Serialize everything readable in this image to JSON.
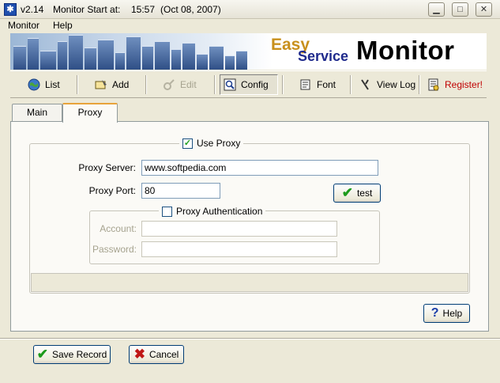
{
  "window": {
    "version": "v2.14",
    "start_label": "Monitor Start at:",
    "start_time": "15:57",
    "start_date": "(Oct 08, 2007)"
  },
  "menu": {
    "items": [
      "Monitor",
      "Help"
    ]
  },
  "banner": {
    "easy": "Easy",
    "service": "Service",
    "monitor": "Monitor"
  },
  "toolbar": {
    "list": "List",
    "add": "Add",
    "edit": "Edit",
    "config": "Config",
    "font": "Font",
    "view_log": "View Log",
    "register": "Register!"
  },
  "tabs": {
    "main": "Main",
    "proxy": "Proxy",
    "active": "Proxy"
  },
  "proxy": {
    "use_proxy_label": "Use Proxy",
    "use_proxy_checked": true,
    "server_label": "Proxy Server:",
    "server_value": "www.softpedia.com",
    "port_label": "Proxy Port:",
    "port_value": "80",
    "test_label": "test",
    "auth_label": "Proxy Authentication",
    "auth_checked": false,
    "account_label": "Account:",
    "account_value": "",
    "password_label": "Password:",
    "password_value": ""
  },
  "buttons": {
    "help": "Help",
    "save": "Save Record",
    "cancel": "Cancel"
  },
  "icons": {
    "app": "app-icon",
    "list": "globe-icon",
    "add": "add-icon",
    "edit": "edit-icon",
    "config": "config-icon",
    "font": "font-icon",
    "view_log": "view-log-icon",
    "register": "register-icon",
    "test": "check-icon",
    "help": "question-icon",
    "save": "check-icon",
    "cancel": "cross-icon"
  },
  "colors": {
    "register_text": "#c00000",
    "accent_tab": "#e8a33b"
  }
}
